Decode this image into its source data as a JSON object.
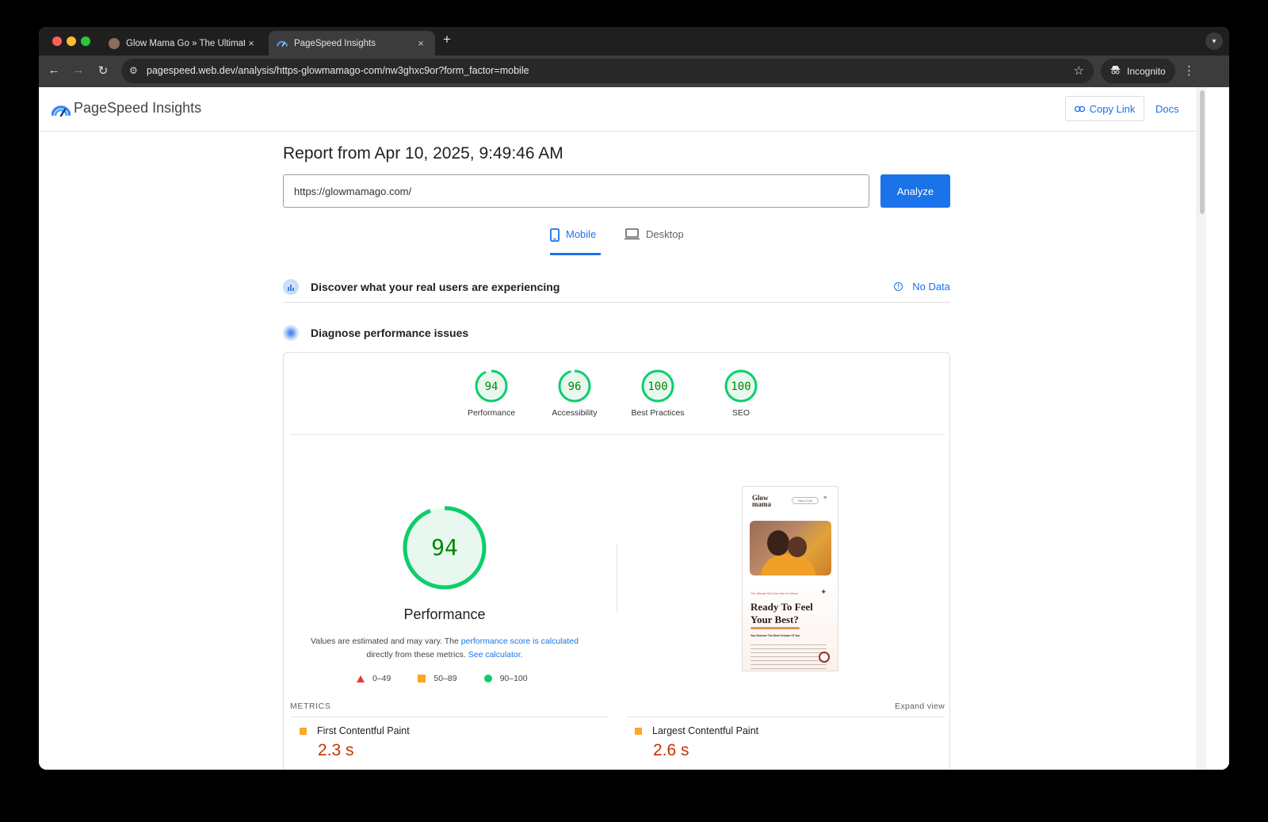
{
  "browser": {
    "tabs": [
      {
        "title": "Glow Mama Go » The Ultimate",
        "close": "×"
      },
      {
        "title": "PageSpeed Insights",
        "close": "×"
      }
    ],
    "new_tab": "+",
    "url": "pagespeed.web.dev/analysis/https-glowmamago-com/nw3ghxc9or?form_factor=mobile",
    "incognito_label": "Incognito"
  },
  "header": {
    "brand": "PageSpeed Insights",
    "copy_link": "Copy Link",
    "docs": "Docs"
  },
  "report": {
    "title": "Report from Apr 10, 2025, 9:49:46 AM",
    "url_value": "https://glowmamago.com/",
    "analyze": "Analyze"
  },
  "form_factor": {
    "mobile": "Mobile",
    "desktop": "Desktop",
    "active": "mobile"
  },
  "sections": {
    "real_users": "Discover what your real users are experiencing",
    "no_data": "No Data",
    "diagnose": "Diagnose performance issues"
  },
  "scores": [
    {
      "label": "Performance",
      "value": 94
    },
    {
      "label": "Accessibility",
      "value": 96
    },
    {
      "label": "Best Practices",
      "value": 100
    },
    {
      "label": "SEO",
      "value": 100
    }
  ],
  "performance": {
    "score": 94,
    "title": "Performance",
    "note_1": "Values are estimated and may vary. The ",
    "note_link_1": "performance score is calculated",
    "note_2": " directly from these metrics. ",
    "note_link_2": "See calculator.",
    "legend": {
      "fail": "0–49",
      "average": "50–89",
      "pass": "90–100"
    }
  },
  "screenshot": {
    "brand_line1": "Glow",
    "brand_line2": "mama",
    "pill": "Take A Quiz",
    "kicker": "The Ultimate Self-Care Hub For Moms",
    "headline": "Ready To Feel Your Best?",
    "subhead": "You Deserve The Best Version Of You"
  },
  "metrics": {
    "heading": "METRICS",
    "expand": "Expand view",
    "items": [
      {
        "name": "First Contentful Paint",
        "value": "2.3 s"
      },
      {
        "name": "Largest Contentful Paint",
        "value": "2.6 s"
      }
    ]
  },
  "colors": {
    "pass": "#0cce6b",
    "pass_fill": "#e8f8ef",
    "pass_text": "#008800",
    "average": "#ffa726",
    "fail": "#e53935",
    "accent": "#1a73e8"
  }
}
